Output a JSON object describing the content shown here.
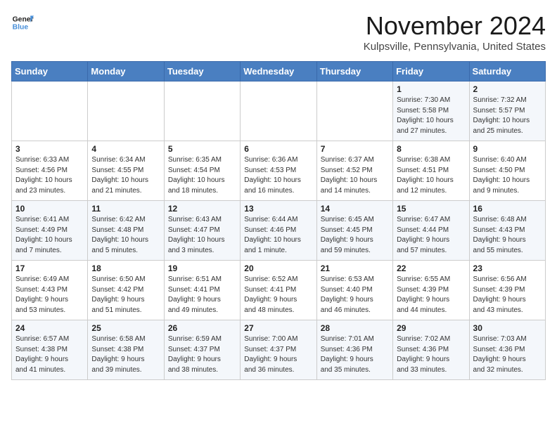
{
  "logo": {
    "line1": "General",
    "line2": "Blue"
  },
  "calendar": {
    "title": "November 2024",
    "subtitle": "Kulpsville, Pennsylvania, United States"
  },
  "days_of_week": [
    "Sunday",
    "Monday",
    "Tuesday",
    "Wednesday",
    "Thursday",
    "Friday",
    "Saturday"
  ],
  "weeks": [
    [
      {
        "day": "",
        "info": ""
      },
      {
        "day": "",
        "info": ""
      },
      {
        "day": "",
        "info": ""
      },
      {
        "day": "",
        "info": ""
      },
      {
        "day": "",
        "info": ""
      },
      {
        "day": "1",
        "info": "Sunrise: 7:30 AM\nSunset: 5:58 PM\nDaylight: 10 hours\nand 27 minutes."
      },
      {
        "day": "2",
        "info": "Sunrise: 7:32 AM\nSunset: 5:57 PM\nDaylight: 10 hours\nand 25 minutes."
      }
    ],
    [
      {
        "day": "3",
        "info": "Sunrise: 6:33 AM\nSunset: 4:56 PM\nDaylight: 10 hours\nand 23 minutes."
      },
      {
        "day": "4",
        "info": "Sunrise: 6:34 AM\nSunset: 4:55 PM\nDaylight: 10 hours\nand 21 minutes."
      },
      {
        "day": "5",
        "info": "Sunrise: 6:35 AM\nSunset: 4:54 PM\nDaylight: 10 hours\nand 18 minutes."
      },
      {
        "day": "6",
        "info": "Sunrise: 6:36 AM\nSunset: 4:53 PM\nDaylight: 10 hours\nand 16 minutes."
      },
      {
        "day": "7",
        "info": "Sunrise: 6:37 AM\nSunset: 4:52 PM\nDaylight: 10 hours\nand 14 minutes."
      },
      {
        "day": "8",
        "info": "Sunrise: 6:38 AM\nSunset: 4:51 PM\nDaylight: 10 hours\nand 12 minutes."
      },
      {
        "day": "9",
        "info": "Sunrise: 6:40 AM\nSunset: 4:50 PM\nDaylight: 10 hours\nand 9 minutes."
      }
    ],
    [
      {
        "day": "10",
        "info": "Sunrise: 6:41 AM\nSunset: 4:49 PM\nDaylight: 10 hours\nand 7 minutes."
      },
      {
        "day": "11",
        "info": "Sunrise: 6:42 AM\nSunset: 4:48 PM\nDaylight: 10 hours\nand 5 minutes."
      },
      {
        "day": "12",
        "info": "Sunrise: 6:43 AM\nSunset: 4:47 PM\nDaylight: 10 hours\nand 3 minutes."
      },
      {
        "day": "13",
        "info": "Sunrise: 6:44 AM\nSunset: 4:46 PM\nDaylight: 10 hours\nand 1 minute."
      },
      {
        "day": "14",
        "info": "Sunrise: 6:45 AM\nSunset: 4:45 PM\nDaylight: 9 hours\nand 59 minutes."
      },
      {
        "day": "15",
        "info": "Sunrise: 6:47 AM\nSunset: 4:44 PM\nDaylight: 9 hours\nand 57 minutes."
      },
      {
        "day": "16",
        "info": "Sunrise: 6:48 AM\nSunset: 4:43 PM\nDaylight: 9 hours\nand 55 minutes."
      }
    ],
    [
      {
        "day": "17",
        "info": "Sunrise: 6:49 AM\nSunset: 4:43 PM\nDaylight: 9 hours\nand 53 minutes."
      },
      {
        "day": "18",
        "info": "Sunrise: 6:50 AM\nSunset: 4:42 PM\nDaylight: 9 hours\nand 51 minutes."
      },
      {
        "day": "19",
        "info": "Sunrise: 6:51 AM\nSunset: 4:41 PM\nDaylight: 9 hours\nand 49 minutes."
      },
      {
        "day": "20",
        "info": "Sunrise: 6:52 AM\nSunset: 4:41 PM\nDaylight: 9 hours\nand 48 minutes."
      },
      {
        "day": "21",
        "info": "Sunrise: 6:53 AM\nSunset: 4:40 PM\nDaylight: 9 hours\nand 46 minutes."
      },
      {
        "day": "22",
        "info": "Sunrise: 6:55 AM\nSunset: 4:39 PM\nDaylight: 9 hours\nand 44 minutes."
      },
      {
        "day": "23",
        "info": "Sunrise: 6:56 AM\nSunset: 4:39 PM\nDaylight: 9 hours\nand 43 minutes."
      }
    ],
    [
      {
        "day": "24",
        "info": "Sunrise: 6:57 AM\nSunset: 4:38 PM\nDaylight: 9 hours\nand 41 minutes."
      },
      {
        "day": "25",
        "info": "Sunrise: 6:58 AM\nSunset: 4:38 PM\nDaylight: 9 hours\nand 39 minutes."
      },
      {
        "day": "26",
        "info": "Sunrise: 6:59 AM\nSunset: 4:37 PM\nDaylight: 9 hours\nand 38 minutes."
      },
      {
        "day": "27",
        "info": "Sunrise: 7:00 AM\nSunset: 4:37 PM\nDaylight: 9 hours\nand 36 minutes."
      },
      {
        "day": "28",
        "info": "Sunrise: 7:01 AM\nSunset: 4:36 PM\nDaylight: 9 hours\nand 35 minutes."
      },
      {
        "day": "29",
        "info": "Sunrise: 7:02 AM\nSunset: 4:36 PM\nDaylight: 9 hours\nand 33 minutes."
      },
      {
        "day": "30",
        "info": "Sunrise: 7:03 AM\nSunset: 4:36 PM\nDaylight: 9 hours\nand 32 minutes."
      }
    ]
  ]
}
